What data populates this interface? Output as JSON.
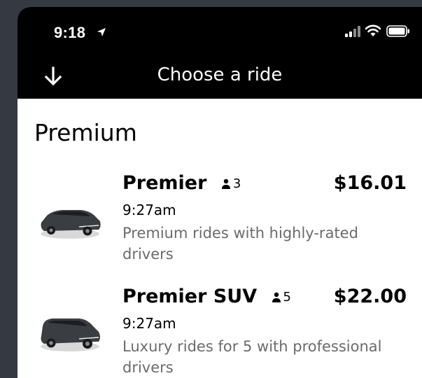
{
  "status_bar": {
    "time": "9:18",
    "icons": [
      "location-arrow-icon",
      "signal-icon",
      "wifi-icon",
      "battery-icon"
    ]
  },
  "header": {
    "back_icon": "down-arrow-icon",
    "title": "Choose a ride"
  },
  "section": {
    "title": "Premium"
  },
  "rides": [
    {
      "name": "Premier",
      "capacity": "3",
      "price": "$16.01",
      "eta": "9:27am",
      "description": "Premium rides with highly-rated drivers",
      "icon": "sedan-car-icon"
    },
    {
      "name": "Premier SUV",
      "capacity": "5",
      "price": "$22.00",
      "eta": "9:27am",
      "description": "Luxury rides for 5 with professional drivers",
      "icon": "suv-car-icon"
    }
  ],
  "colors": {
    "background": "#353a42",
    "header": "#000000",
    "secondary_text": "#6b6b6b"
  }
}
